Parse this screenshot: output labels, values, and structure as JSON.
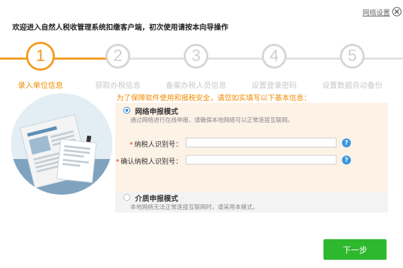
{
  "header": {
    "network_settings_label": "网络设置",
    "welcome_text": "欢迎进入自然人税收管理系统扣缴客户端，初次使用请按本向导操作"
  },
  "steps": [
    {
      "number": "1",
      "label": "录入单位信息",
      "active": true
    },
    {
      "number": "2",
      "label": "获取办税信息",
      "active": false
    },
    {
      "number": "3",
      "label": "备案办税人员信息",
      "active": false
    },
    {
      "number": "4",
      "label": "设置登录密码",
      "active": false
    },
    {
      "number": "5",
      "label": "设置数据自动备份",
      "active": false
    }
  ],
  "form": {
    "notice": "为了保障软件使用和报税安全，请您如实填写以下基本信息：",
    "online_mode": {
      "title": "网络申报模式",
      "description": "通过网络进行在线申报，请确保本地网络可以正常连接互联网。",
      "selected": true
    },
    "fields": {
      "taxpayer_id_label": "纳税人识别号：",
      "taxpayer_id_value": "",
      "confirm_taxpayer_id_label": "确认纳税人识别号：",
      "confirm_taxpayer_id_value": "",
      "required_mark": "*",
      "help_glyph": "?"
    },
    "media_mode": {
      "title": "介质申报模式",
      "description": "本地网络无法正常连接互联网时，请采用本模式。",
      "selected": false
    }
  },
  "footer": {
    "next_label": "下一步"
  },
  "colors": {
    "accent": "#f39a1d",
    "primary_button": "#2eb82e",
    "link_blue": "#2e8bd8"
  }
}
